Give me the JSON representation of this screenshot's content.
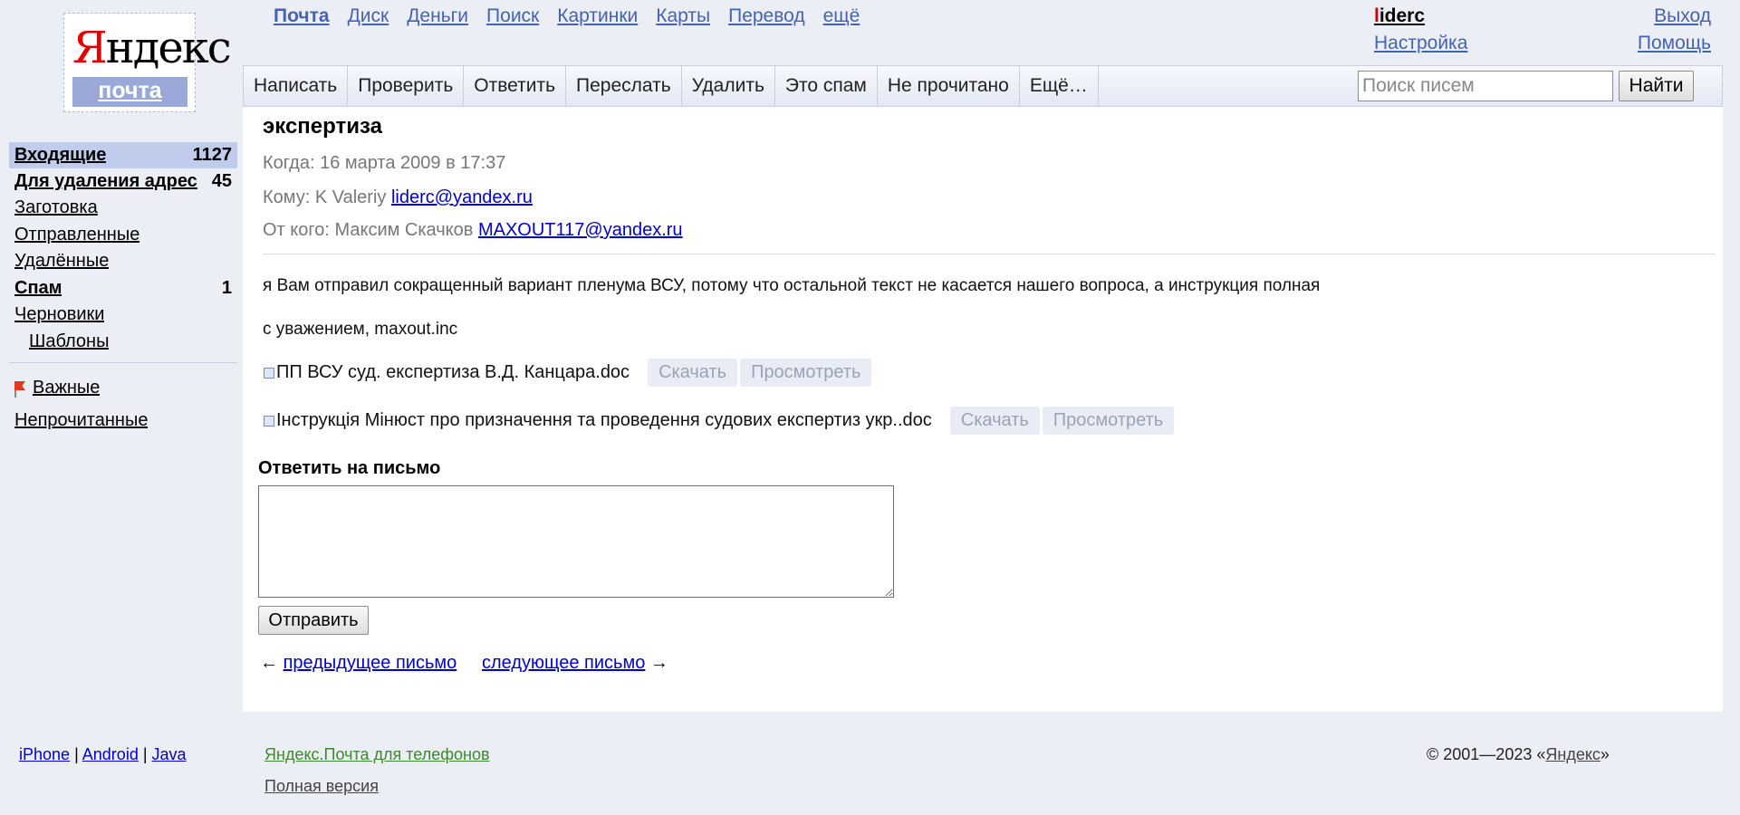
{
  "logo": {
    "word_first": "Я",
    "word_rest": "ндекс",
    "service": "почта"
  },
  "topnav": [
    "Почта",
    "Диск",
    "Деньги",
    "Поиск",
    "Картинки",
    "Карты",
    "Перевод",
    "ещё"
  ],
  "user": {
    "first": "l",
    "rest": "iderc",
    "settings": "Настройка",
    "logout": "Выход",
    "help": "Помощь"
  },
  "toolbar": [
    "Написать",
    "Проверить",
    "Ответить",
    "Переслать",
    "Удалить",
    "Это спам",
    "Не прочитано",
    "Ещё…"
  ],
  "search": {
    "placeholder": "Поиск писем",
    "button": "Найти"
  },
  "folders": [
    {
      "name": "Входящие",
      "count": "1127"
    },
    {
      "name": "Для удаления адрес",
      "count": "45"
    },
    {
      "name": "Заготовка",
      "count": ""
    },
    {
      "name": "Отправленные",
      "count": ""
    },
    {
      "name": "Удалённые",
      "count": ""
    },
    {
      "name": "Спам",
      "count": "1"
    },
    {
      "name": "Черновики",
      "count": ""
    },
    {
      "name": "Шаблоны",
      "count": ""
    }
  ],
  "labels": {
    "important": "Важные",
    "unread": "Непрочитанные"
  },
  "message": {
    "subject": "экспертиза",
    "when": "Когда: 16 марта 2009 в 17:37",
    "to_prefix": "Кому: K Valeriy",
    "to_email": "liderc@yandex.ru",
    "from_prefix": "От кого: Максим Скачков",
    "from_email": "MAXOUT117@yandex.ru",
    "body": "я Вам отправил сокращенный вариант пленума ВСУ, потому что остальной текст не касается нашего вопроса, а инструкция полная",
    "signature": "с уважением, maxout.inc"
  },
  "attachments": [
    {
      "name": "ПП ВСУ суд. експертиза В.Д. Канцара.doc",
      "download": "Скачать",
      "view": "Просмотреть"
    },
    {
      "name": "Інструкція Мінюст про призначення та проведення судових експертиз укр..doc",
      "download": "Скачать",
      "view": "Просмотреть"
    }
  ],
  "reply": {
    "label": "Ответить на письмо",
    "send": "Отправить"
  },
  "pager": {
    "prev_arrow": "←",
    "prev": "предыдущее письмо",
    "next": "следующее письмо",
    "next_arrow": "→"
  },
  "footer": {
    "iphone": "iPhone",
    "android": "Android",
    "java": "Java",
    "sep": "|",
    "mobile": "Яндекс.Почта для телефонов",
    "full": "Полная версия",
    "copy_prefix": "© 2001—2023 «",
    "copy_link": "Яндекс",
    "copy_suffix": "»"
  },
  "colors": {
    "link": "#0000cc",
    "nav_link": "#4563b0",
    "selected_folder": "#bfcceb",
    "background": "#eceef6"
  }
}
